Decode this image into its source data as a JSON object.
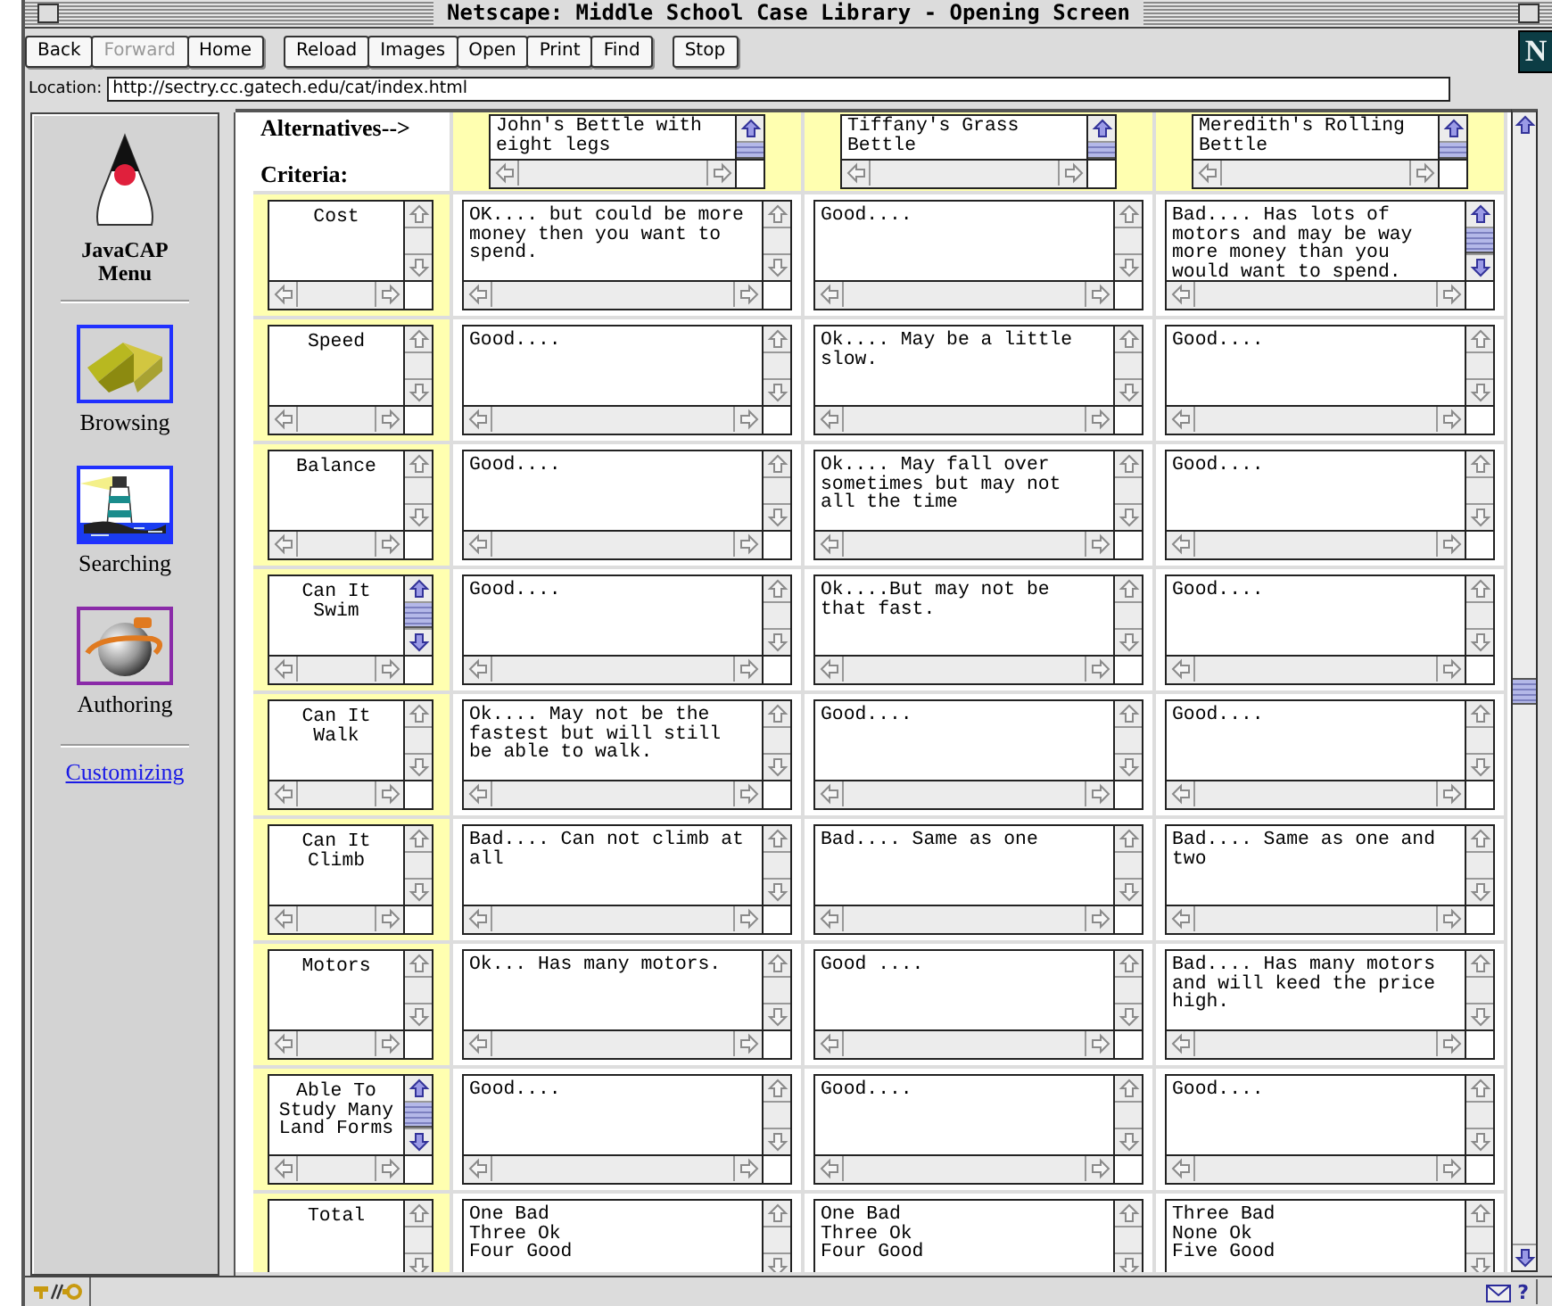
{
  "window": {
    "title": "Netscape: Middle School Case Library - Opening Screen"
  },
  "toolbar": {
    "groups": [
      [
        {
          "label": "Back",
          "disabled": false
        },
        {
          "label": "Forward",
          "disabled": true
        },
        {
          "label": "Home",
          "disabled": false
        }
      ],
      [
        {
          "label": "Reload",
          "disabled": false
        },
        {
          "label": "Images",
          "disabled": false
        },
        {
          "label": "Open",
          "disabled": false
        },
        {
          "label": "Print",
          "disabled": false
        },
        {
          "label": "Find",
          "disabled": false
        }
      ],
      [
        {
          "label": "Stop",
          "disabled": false
        }
      ]
    ],
    "brand_mark": "N"
  },
  "location": {
    "label": "Location:",
    "value": "http://sectry.cc.gatech.edu/cat/index.html"
  },
  "sidebar": {
    "title": "JavaCAP Menu",
    "items": [
      {
        "label": "Browsing",
        "kind": "book",
        "visited": false
      },
      {
        "label": "Searching",
        "kind": "lighthouse",
        "visited": false
      },
      {
        "label": "Authoring",
        "kind": "sphere",
        "visited": true
      }
    ],
    "link": "Customizing"
  },
  "table": {
    "alternatives_label": "Alternatives-->",
    "criteria_label": "Criteria:",
    "alternatives": [
      {
        "text": "John's Bettle with eight legs",
        "scrollable": true
      },
      {
        "text": "Tiffany's Grass Bettle",
        "scrollable": true
      },
      {
        "text": "Meredith's Rolling Bettle",
        "scrollable": true
      }
    ],
    "rows": [
      {
        "criterion": {
          "text": "Cost",
          "scrollable": false
        },
        "cells": [
          {
            "text": "OK.... but could be more money then you want to spend.",
            "scrollable": false
          },
          {
            "text": "Good....",
            "scrollable": false
          },
          {
            "text": "Bad.... Has lots of motors and may be way more money than you would want to spend.",
            "scrollable": true
          }
        ]
      },
      {
        "criterion": {
          "text": "Speed",
          "scrollable": false
        },
        "cells": [
          {
            "text": "Good....",
            "scrollable": false
          },
          {
            "text": "Ok.... May be a little slow.",
            "scrollable": false
          },
          {
            "text": "Good....",
            "scrollable": false
          }
        ]
      },
      {
        "criterion": {
          "text": "Balance",
          "scrollable": false
        },
        "cells": [
          {
            "text": "Good....",
            "scrollable": false
          },
          {
            "text": "Ok.... May fall over sometimes but may not all the time",
            "scrollable": false
          },
          {
            "text": "Good....",
            "scrollable": false
          }
        ]
      },
      {
        "criterion": {
          "text": "Can It Swim",
          "scrollable": true
        },
        "cells": [
          {
            "text": "Good....",
            "scrollable": false
          },
          {
            "text": "Ok....But may not be that fast.",
            "scrollable": false
          },
          {
            "text": "Good....",
            "scrollable": false
          }
        ]
      },
      {
        "criterion": {
          "text": "Can It Walk",
          "scrollable": false
        },
        "cells": [
          {
            "text": "Ok.... May not be the fastest but will still be able to walk.",
            "scrollable": false
          },
          {
            "text": "Good....",
            "scrollable": false
          },
          {
            "text": "Good....",
            "scrollable": false
          }
        ]
      },
      {
        "criterion": {
          "text": "Can It Climb",
          "scrollable": false
        },
        "cells": [
          {
            "text": "Bad.... Can not climb at all",
            "scrollable": false
          },
          {
            "text": "Bad.... Same as one",
            "scrollable": false
          },
          {
            "text": "Bad.... Same as one and two",
            "scrollable": false
          }
        ]
      },
      {
        "criterion": {
          "text": "Motors",
          "scrollable": false
        },
        "cells": [
          {
            "text": "Ok... Has many motors.",
            "scrollable": false
          },
          {
            "text": "Good ....",
            "scrollable": false
          },
          {
            "text": "Bad.... Has many motors and will keed the price high.",
            "scrollable": false
          }
        ]
      },
      {
        "criterion": {
          "text": "Able To Study Many Land Forms",
          "scrollable": true
        },
        "cells": [
          {
            "text": "Good....",
            "scrollable": false
          },
          {
            "text": "Good....",
            "scrollable": false
          },
          {
            "text": "Good....",
            "scrollable": false
          }
        ]
      },
      {
        "criterion": {
          "text": "Total",
          "scrollable": false
        },
        "cells": [
          {
            "text": "One Bad\nThree Ok\nFour Good",
            "scrollable": false
          },
          {
            "text": "One Bad\nThree Ok\nFour Good",
            "scrollable": false
          },
          {
            "text": "Three Bad\nNone Ok\nFive Good",
            "scrollable": false
          }
        ]
      }
    ]
  },
  "status_bar": {
    "help": "?"
  }
}
